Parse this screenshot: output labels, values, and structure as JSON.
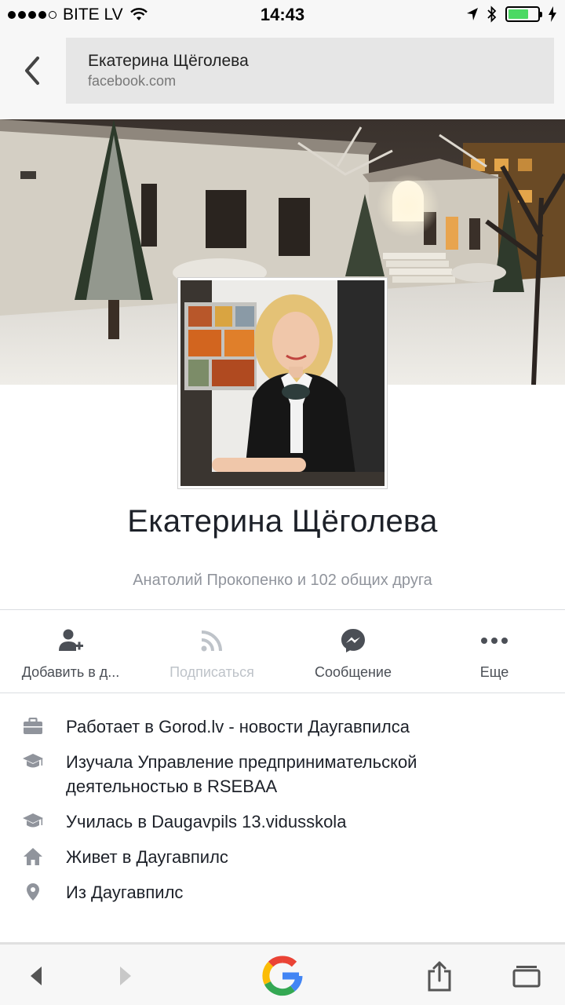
{
  "status_bar": {
    "carrier": "BITE LV",
    "time": "14:43",
    "battery_level": 0.7,
    "battery_color": "#4cd964"
  },
  "browser": {
    "page_title": "Екатерина Щёголева",
    "host": "facebook.com"
  },
  "profile": {
    "name": "Екатерина Щёголева",
    "mutual_friends": "Анатолий Прокопенко и 102 общих друга"
  },
  "actions": [
    {
      "label": "Добавить в д...",
      "icon": "add-friend-icon"
    },
    {
      "label": "Подписаться",
      "icon": "rss-icon"
    },
    {
      "label": "Сообщение",
      "icon": "messenger-icon"
    },
    {
      "label": "Еще",
      "icon": "more-icon"
    }
  ],
  "info": [
    {
      "icon": "briefcase-icon",
      "text": "Работает в Gorod.lv - новости Даугавпилса"
    },
    {
      "icon": "graduation-cap-icon",
      "text": "Изучала Управление предпринимательской деятельностью в RSEBAA"
    },
    {
      "icon": "graduation-cap-icon",
      "text": "Училась в Daugavpils 13.vidusskola"
    },
    {
      "icon": "home-icon",
      "text": "Живет в Даугавпилс"
    },
    {
      "icon": "location-pin-icon",
      "text": "Из Даугавпилс"
    }
  ],
  "toolbar": {
    "icons": [
      "back-arrow-icon",
      "forward-arrow-icon",
      "google-icon",
      "share-icon",
      "tabs-icon"
    ]
  }
}
